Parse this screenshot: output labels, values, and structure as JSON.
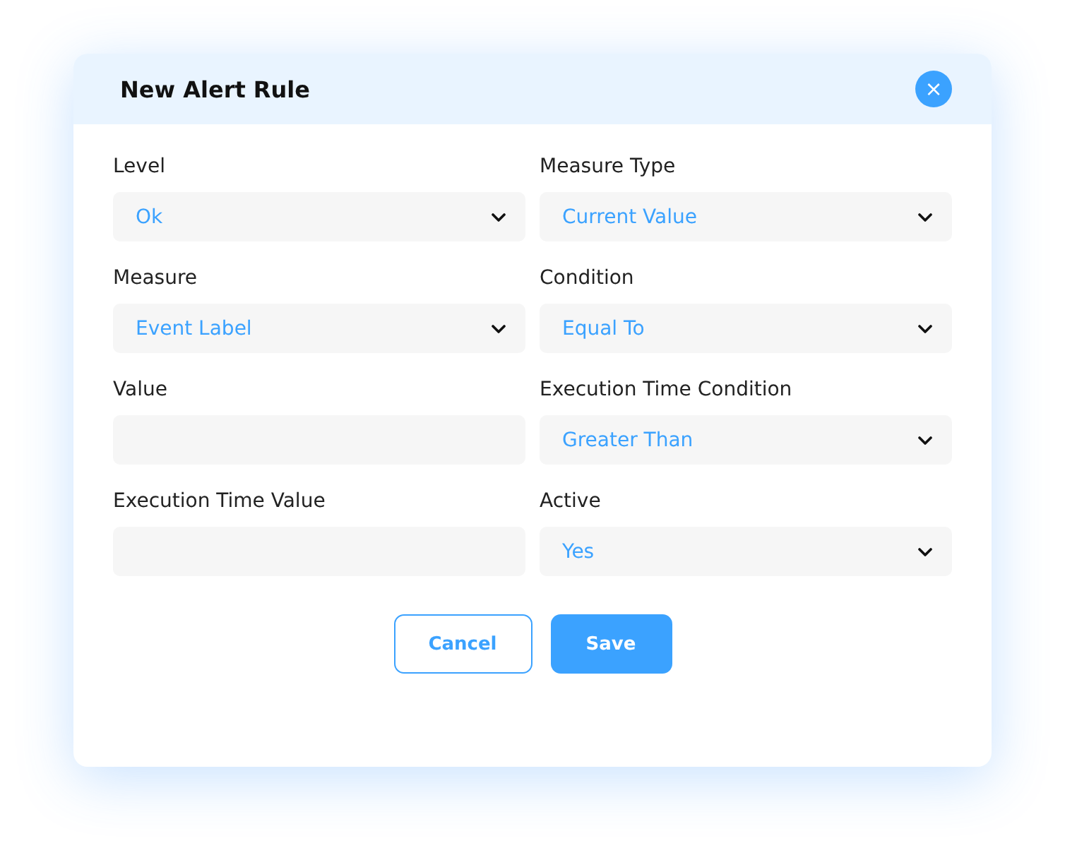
{
  "dialog": {
    "title": "New Alert Rule",
    "close": "×"
  },
  "fields": [
    {
      "label": "Level",
      "kind": "select",
      "value": "Ok"
    },
    {
      "label": "Measure Type",
      "kind": "select",
      "value": "Current Value"
    },
    {
      "label": "Measure",
      "kind": "select",
      "value": "Event Label"
    },
    {
      "label": "Condition",
      "kind": "select",
      "value": "Equal To"
    },
    {
      "label": "Value",
      "kind": "input"
    },
    {
      "label": "Execution Time Condition",
      "kind": "select",
      "value": "Greater Than"
    },
    {
      "label": "Execution Time Value",
      "kind": "input"
    },
    {
      "label": "Active",
      "kind": "select",
      "value": "Yes"
    }
  ],
  "buttons": [
    {
      "label": "Cancel",
      "kind": "secondary"
    },
    {
      "label": "Save",
      "kind": "primary"
    }
  ]
}
